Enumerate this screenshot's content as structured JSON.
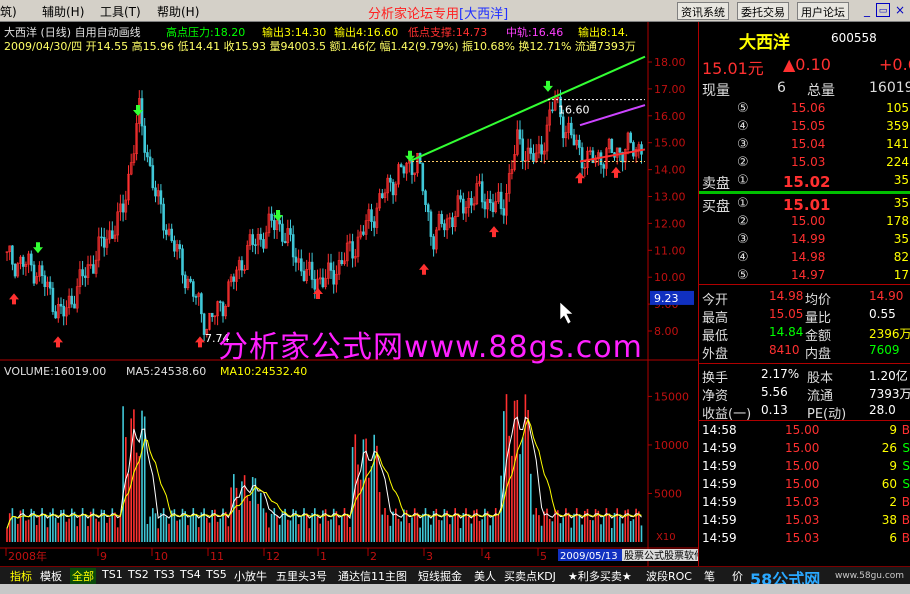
{
  "menu": {
    "items": [
      "筑)",
      "辅助(H)",
      "工具(T)",
      "帮助(H)"
    ]
  },
  "window_title": "分析家论坛专用",
  "window_symbol": "[大西洋]",
  "top_buttons": [
    "资讯系统",
    "委托交易",
    "用户论坛"
  ],
  "chart_header": {
    "line1": "大西洋 (日线) 自用自动画线",
    "line1_parts": [
      {
        "text": "高点压力:18.20",
        "color": "#00ff00"
      },
      {
        "text": "输出3:14.30",
        "color": "#ffff00"
      },
      {
        "text": "输出4:16.60",
        "color": "#ffff00"
      },
      {
        "text": "低点支撑:14.73",
        "color": "#ff3030"
      },
      {
        "text": "中轨:16.46",
        "color": "#ff40ff"
      },
      {
        "text": "输出8:14.",
        "color": "#ffff00"
      }
    ],
    "line2": "2009/04/30/四 开14.55 高15.96 低14.41 收15.93 量94003.5 额1.46亿 幅1.42(9.79%) 振10.68% 换12.71% 流通7393万"
  },
  "price_axis": [
    "18.00",
    "17.00",
    "16.00",
    "15.00",
    "14.00",
    "13.00",
    "12.00",
    "11.00",
    "10.00",
    "9.00",
    "8.00"
  ],
  "price_marker": "9.23",
  "price_annotations": {
    "high_label": "16.60",
    "low_label": "7.74"
  },
  "volume_header": {
    "volume": "VOLUME:16019.00",
    "ma5": "MA5:24538.60",
    "ma10": "MA10:24532.40"
  },
  "volume_axis": [
    "15000",
    "10000",
    "5000"
  ],
  "volume_unit": "X10",
  "date_axis": [
    "2008年",
    "9",
    "10",
    "11",
    "12",
    "1",
    "2",
    "3",
    "4",
    "5"
  ],
  "date_marker": "2009/05/13",
  "marquee": "股票公式股票软件下载[分析家公式网www.88gs.com]",
  "watermark": "分析家公式网www.88gs.com",
  "watermark2": "58公式网",
  "watermark3": "www.58gu.com",
  "right_panel": {
    "stock_name": "大西洋",
    "stock_code": "600558",
    "price": "15.01元",
    "change": "▲0.10",
    "change_pct": "+0.6",
    "current_vol_label": "现量",
    "current_vol": "6",
    "total_vol_label": "总量",
    "total_vol": "16019",
    "sell_label": "卖盘",
    "buy_label": "买盘",
    "sell_levels": [
      {
        "n": "⑤",
        "price": "15.06",
        "vol": "105"
      },
      {
        "n": "④",
        "price": "15.05",
        "vol": "359"
      },
      {
        "n": "③",
        "price": "15.04",
        "vol": "141"
      },
      {
        "n": "②",
        "price": "15.03",
        "vol": "224"
      },
      {
        "n": "①",
        "price": "15.02",
        "vol": "35"
      }
    ],
    "buy_levels": [
      {
        "n": "①",
        "price": "15.01",
        "vol": "35"
      },
      {
        "n": "②",
        "price": "15.00",
        "vol": "178"
      },
      {
        "n": "③",
        "price": "14.99",
        "vol": "35"
      },
      {
        "n": "④",
        "price": "14.98",
        "vol": "82"
      },
      {
        "n": "⑤",
        "price": "14.97",
        "vol": "17"
      }
    ],
    "stats": [
      {
        "l1": "今开",
        "v1": "14.98",
        "c1": "#ff3030",
        "l2": "均价",
        "v2": "14.90",
        "c2": "#ff3030"
      },
      {
        "l1": "最高",
        "v1": "15.05",
        "c1": "#ff3030",
        "l2": "量比",
        "v2": "0.55",
        "c2": "#ffffff"
      },
      {
        "l1": "最低",
        "v1": "14.84",
        "c1": "#00ff00",
        "l2": "金额",
        "v2": "2396万",
        "c2": "#ffff00"
      },
      {
        "l1": "外盘",
        "v1": "8410",
        "c1": "#ff3030",
        "l2": "内盘",
        "v2": "7609",
        "c2": "#00ff00"
      }
    ],
    "stats2": [
      {
        "l1": "换手",
        "v1": "2.17%",
        "l2": "股本",
        "v2": "1.20亿"
      },
      {
        "l1": "净资",
        "v1": "5.56",
        "l2": "流通",
        "v2": "7393万"
      },
      {
        "l1": "收益(一)",
        "v1": "0.13",
        "l2": "PE(动)",
        "v2": "28.0"
      }
    ],
    "ticks": [
      {
        "time": "14:58",
        "price": "15.00",
        "vol": "9",
        "flag": "B"
      },
      {
        "time": "14:59",
        "price": "15.00",
        "vol": "26",
        "flag": "S"
      },
      {
        "time": "14:59",
        "price": "15.00",
        "vol": "9",
        "flag": "S"
      },
      {
        "time": "14:59",
        "price": "15.00",
        "vol": "60",
        "flag": "S"
      },
      {
        "time": "14:59",
        "price": "15.03",
        "vol": "2",
        "flag": "B"
      },
      {
        "time": "14:59",
        "price": "15.03",
        "vol": "38",
        "flag": "B"
      },
      {
        "time": "14:59",
        "price": "15.03",
        "vol": "6",
        "flag": "B"
      }
    ]
  },
  "tabs": [
    "指标",
    "模板",
    "全部",
    "TS1",
    "TS2",
    "TS3",
    "TS4",
    "TS5",
    "小放牛",
    "五里头3号",
    "通达信11主图",
    "短线掘金",
    "美人",
    "买卖点KDJ",
    "★利多买卖★",
    "波段ROC",
    "笔",
    "价"
  ],
  "colors": {
    "up": "#ff3030",
    "down": "#40c8d8",
    "ma5": "#ffffff",
    "ma10": "#ffff00",
    "trend_up": "#33ff33",
    "support": "#ff3030",
    "mid": "#cc44ff"
  }
}
